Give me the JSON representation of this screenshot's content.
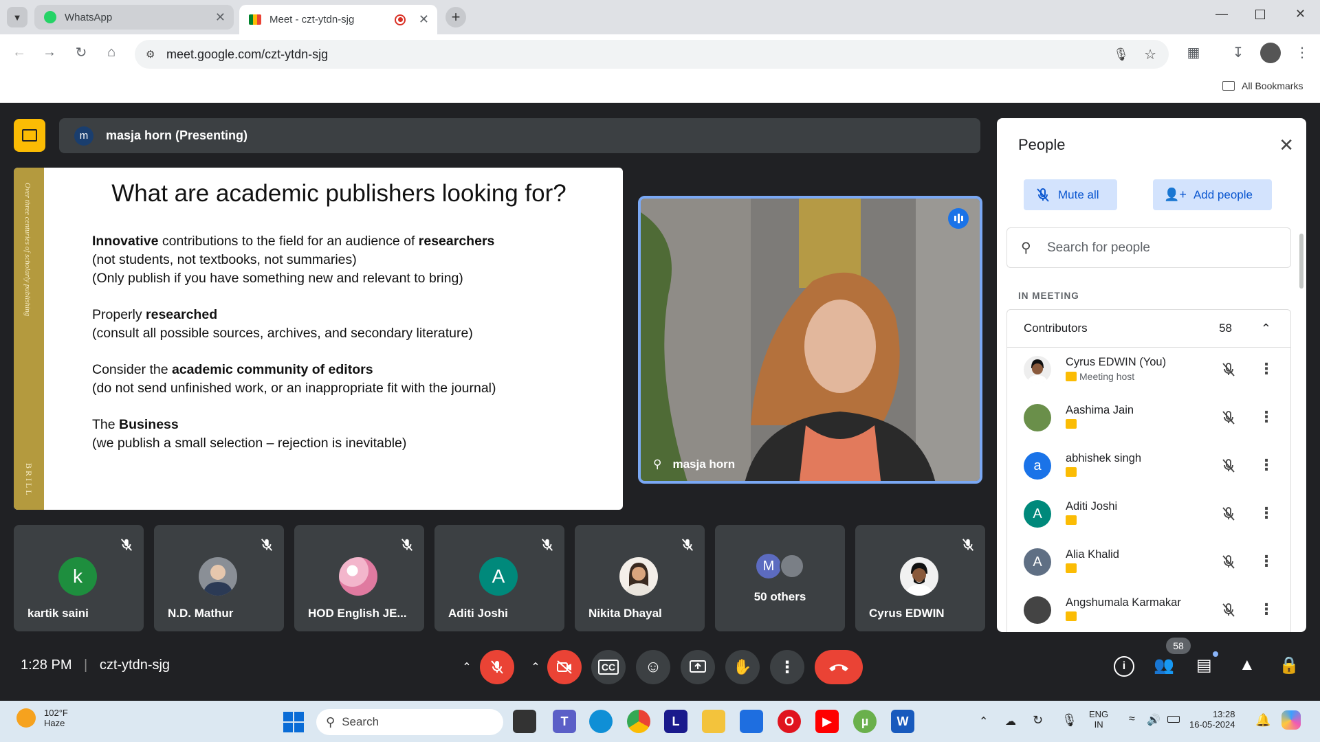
{
  "browser": {
    "tabs": [
      {
        "label": "WhatsApp",
        "icon": "whatsapp-icon"
      },
      {
        "label": "Meet - czt-ytdn-sjg",
        "icon": "meet-icon"
      }
    ],
    "url": "meet.google.com/czt-ytdn-sjg",
    "bookmarks_label": "All Bookmarks"
  },
  "meet": {
    "presenting_banner": "masja horn (Presenting)",
    "presenter_initial": "m",
    "slide": {
      "title": "What are academic publishers looking for?",
      "side_text": "Over three centuries of scholarly publishing",
      "brand": "BRILL",
      "points": [
        {
          "bold": "Innovative",
          "text": " contributions to the field for an audience of ",
          "bold2": "researchers",
          "line2": "(not students, not textbooks, not summaries)",
          "line3": "(Only publish if you have something new and relevant to bring)"
        },
        {
          "pre": "Properly ",
          "bold": "researched",
          "line2": "(consult all possible sources, archives, and secondary literature)"
        },
        {
          "pre": "Consider the ",
          "bold": "academic community of editors",
          "line2": "(do not send unfinished work, or an inappropriate fit with the journal)"
        },
        {
          "pre": "The ",
          "bold": "Business",
          "line2": "(we publish a small selection – rejection is inevitable)"
        }
      ]
    },
    "speaker_name": "masja horn",
    "tiles": [
      {
        "name": "kartik saini",
        "initial": "k",
        "color": "#1e8e3e"
      },
      {
        "name": "N.D. Mathur",
        "initial": "",
        "color": "#8a8f96"
      },
      {
        "name": "HOD English JE...",
        "initial": "",
        "color": "#e8a0b8"
      },
      {
        "name": "Aditi Joshi",
        "initial": "A",
        "color": "#00897b"
      },
      {
        "name": "Nikita Dhayal",
        "initial": "",
        "color": "#c9a27a"
      },
      {
        "name": "50 others",
        "initial": "M",
        "color": "#5c6bc0"
      },
      {
        "name": "Cyrus EDWIN",
        "initial": "",
        "color": "#222222"
      }
    ],
    "time": "1:28 PM",
    "meeting_code": "czt-ytdn-sjg",
    "participant_count": "58"
  },
  "people_panel": {
    "title": "People",
    "mute_all": "Mute all",
    "add_people": "Add people",
    "search_placeholder": "Search for people",
    "section": "IN MEETING",
    "group_label": "Contributors",
    "group_count": "58",
    "participants": [
      {
        "name": "Cyrus EDWIN (You)",
        "sub": "Meeting host",
        "initial": "",
        "color": "#333333"
      },
      {
        "name": "Aashima Jain",
        "sub": "",
        "initial": "",
        "color": "#6a8f4a"
      },
      {
        "name": "abhishek singh",
        "sub": "",
        "initial": "a",
        "color": "#1a73e8"
      },
      {
        "name": "Aditi Joshi",
        "sub": "",
        "initial": "A",
        "color": "#00897b"
      },
      {
        "name": "Alia Khalid",
        "sub": "",
        "initial": "A",
        "color": "#5f6f84"
      },
      {
        "name": "Angshumala Karmakar",
        "sub": "",
        "initial": "",
        "color": "#444444"
      }
    ]
  },
  "taskbar": {
    "weather_temp": "102°F",
    "weather_desc": "Haze",
    "search_label": "Search",
    "lang1": "ENG",
    "lang2": "IN",
    "time": "13:28",
    "date": "16-05-2024"
  }
}
